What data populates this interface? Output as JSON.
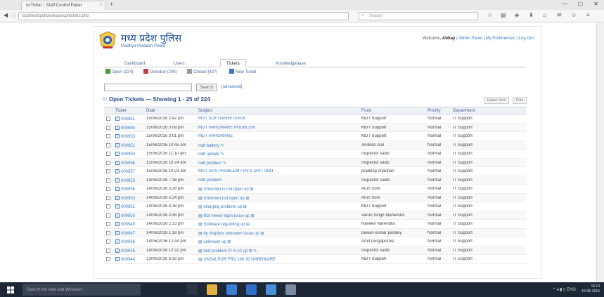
{
  "browser": {
    "tab_title": "osTicket :: Staff Control Panel",
    "url": "localhost/policeshop/scp/tickets.php",
    "search_placeholder": "Search",
    "win_min": "—",
    "win_max": "▢",
    "win_close": "✕"
  },
  "header": {
    "logo_hindi": "मध्य प्रदेश पुलिस",
    "logo_english": "Madhya Pradesh Police",
    "welcome_prefix": "Welcome,",
    "welcome_user": "Abhay",
    "welcome_links": "| Admin Panel | My Preferences | Log Out"
  },
  "main_tabs": [
    {
      "label": "Dashboard"
    },
    {
      "label": "Users"
    },
    {
      "label": "Tickets"
    },
    {
      "label": "Knowledgebase"
    }
  ],
  "sub_tabs": [
    {
      "label": "Open (224)",
      "color": "#4a9a3a"
    },
    {
      "label": "Overdue (206)",
      "color": "#c04040"
    },
    {
      "label": "Closed (437)",
      "color": "#888888"
    },
    {
      "label": "New Ticket",
      "color": "#3a78c2"
    }
  ],
  "search": {
    "button_label": "Search",
    "advanced_label": "[advanced]"
  },
  "list": {
    "title": "Open Tickets — Showing  1 - 25 of 224",
    "exports": [
      "Export View",
      "Print"
    ]
  },
  "columns": [
    "Ticket",
    "Date",
    "Subject",
    "From",
    "Priority",
    "Department"
  ],
  "rows": [
    {
      "ticket": "000951",
      "date": "15/06/2016 2:42 pm",
      "subject": "MDT SOFTWARE ISSUE",
      "from": "MDT Support",
      "priority": "Normal",
      "dept": "IT Support"
    },
    {
      "ticket": "000954",
      "date": "15/06/2016 3:09 pm",
      "subject": "MDT HARDWARE PROBLEM",
      "from": "MDT Support",
      "priority": "Normal",
      "dept": "IT Support"
    },
    {
      "ticket": "000953",
      "date": "15/06/2016 3:01 pm",
      "subject": "MDT HARDWARE",
      "from": "MDT Support",
      "priority": "Normal",
      "dept": "IT Support"
    },
    {
      "ticket": "000951",
      "date": "15/06/2016 10:45 am",
      "subject": "mdt battery ✎",
      "from": "Anibran Anil",
      "priority": "Normal",
      "dept": "IT Support"
    },
    {
      "ticket": "000950",
      "date": "15/06/2016 11:10 am",
      "subject": "mdt update ✎",
      "from": "Inspector sadic",
      "priority": "Normal",
      "dept": "IT Support"
    },
    {
      "ticket": "000958",
      "date": "15/06/2016 10:24 am",
      "subject": "mdt problem ✎",
      "from": "Inspector sadic",
      "priority": "Normal",
      "dept": "IT Support"
    },
    {
      "ticket": "000957",
      "date": "15/06/2016 10:23 am",
      "subject": "MDT GPS PROBLEM FRV 6 DIST VDH",
      "from": "pradeep chauhan",
      "priority": "Normal",
      "dept": "IT Support"
    },
    {
      "ticket": "000953",
      "date": "14/06/2016 7:38 pm",
      "subject": "mdt problem",
      "from": "Inspector sadic",
      "priority": "Normal",
      "dept": "IT Support"
    },
    {
      "ticket": "000955",
      "date": "14/06/2016 5:26 pm",
      "subject": "▤ Unknown is not open up ⊞",
      "from": "Arun Soni",
      "priority": "Normal",
      "dept": "IT Support"
    },
    {
      "ticket": "000953",
      "date": "14/06/2016 5:24 pm",
      "subject": "▤ Unknown not open up ⊞",
      "from": "Arun Soni",
      "priority": "Normal",
      "dept": "IT Support"
    },
    {
      "ticket": "000951",
      "date": "14/06/2016 4:18 pm",
      "subject": "▤ charging problem up ⊞",
      "from": "MDT Support",
      "priority": "Normal",
      "dept": "IT Support"
    },
    {
      "ticket": "000950",
      "date": "14/06/2016 3:45 pm",
      "subject": "▤ Not newer login issue up ⊞",
      "from": "Varun Singh Mahendra",
      "priority": "Normal",
      "dept": "IT Support"
    },
    {
      "ticket": "000949",
      "date": "14/06/2016 2:13 pm",
      "subject": "▤ Software regarding up ⊞",
      "from": "Naveen Narendra",
      "priority": "Normal",
      "dept": "IT Support"
    },
    {
      "ticket": "000947",
      "date": "14/06/2016 1:18 pm",
      "subject": "▤ dy dropbox unknown issue up ⊞",
      "from": "pawan kumar pandey",
      "priority": "Normal",
      "dept": "IT Support"
    },
    {
      "ticket": "000946",
      "date": "14/06/2016 12:44 pm",
      "subject": "▤ unknown up ⊞",
      "from": "Amit Durgapurasi",
      "priority": "Normal",
      "dept": "IT Support"
    },
    {
      "ticket": "000945",
      "date": "14/06/2016 12:32 pm",
      "subject": "▤ mdt problem Fr 8-10 up ⊞ ✎",
      "from": "Inspector sadic",
      "priority": "Normal",
      "dept": "IT Support"
    },
    {
      "ticket": "000944",
      "date": "13/06/2016 6:19 pm",
      "subject": "▤ UNSALPUR FRV 100 30 HARDWARE",
      "from": "MDT Support",
      "priority": "Normal",
      "dept": "IT Support"
    }
  ],
  "taskbar": {
    "search_placeholder": "Search the web and Windows",
    "apps": [
      {
        "name": "task-view",
        "color": "#2b3546"
      },
      {
        "name": "explorer",
        "color": "#e3b341"
      },
      {
        "name": "chrome",
        "color": "#3c7dd8"
      },
      {
        "name": "store",
        "color": "#2f6fc7"
      },
      {
        "name": "files",
        "color": "#4a90d9"
      },
      {
        "name": "app",
        "color": "#7a8aa0"
      }
    ],
    "tray_text": "^ ◂ ▮ ▯ ENG",
    "time": "15:14",
    "date": "15-06-2016"
  }
}
